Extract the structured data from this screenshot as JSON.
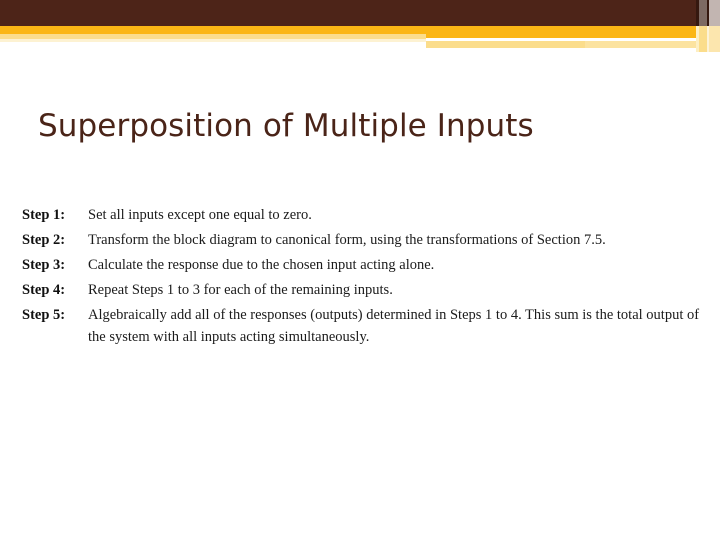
{
  "slide": {
    "title": "Superposition of Multiple Inputs",
    "colors": {
      "header_brown": "#4d2418",
      "header_orange": "#fbb615",
      "header_pale_yellow": "#fbdd8c",
      "header_pale_cream": "#fdf2d2",
      "stripe_dark": "#35180f",
      "stripe_mauve": "#7d6a63",
      "stripe_light": "#c2b5b1",
      "title_text": "#4a2418",
      "body_text": "#1b1b1b",
      "background": "#ffffff"
    },
    "steps": [
      {
        "label": "Step 1:",
        "text": "Set all inputs except one equal to zero."
      },
      {
        "label": "Step 2:",
        "text": "Transform the block diagram to canonical form, using the transformations of Section 7.5."
      },
      {
        "label": "Step 3:",
        "text": "Calculate the response due to the chosen input acting alone."
      },
      {
        "label": "Step 4:",
        "text": "Repeat Steps 1 to 3 for each of the remaining inputs."
      },
      {
        "label": "Step 5:",
        "text": "Algebraically add all of the responses (outputs) determined in Steps 1 to 4. This sum is the total output of the system with all inputs acting simultaneously."
      }
    ]
  }
}
